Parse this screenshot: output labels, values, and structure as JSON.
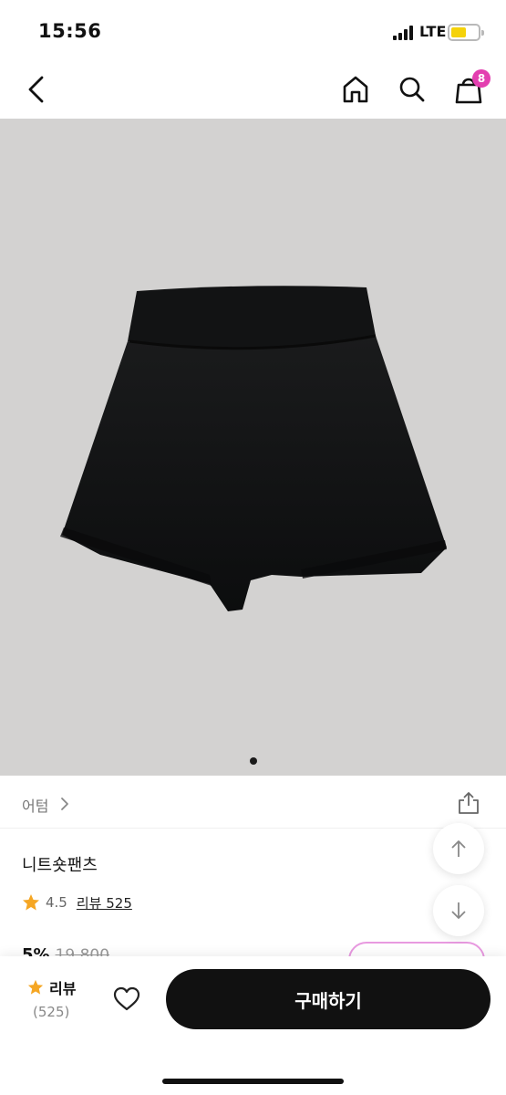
{
  "status_bar": {
    "time": "15:56",
    "network": "LTE",
    "battery_color": "#f5d20a"
  },
  "nav": {
    "back_icon": "chevron-left-icon",
    "home_icon": "home-icon",
    "search_icon": "search-icon",
    "cart_icon": "shopping-bag-icon",
    "cart_count": "8",
    "badge_color": "#e33fb0"
  },
  "product": {
    "image_description_icon": "knit-shorts-photo",
    "carousel": {
      "count": 1,
      "active": 0
    },
    "brand": "어텀",
    "title": "니트숏팬츠",
    "rating": "4.5",
    "review_link": "리뷰 525",
    "discount": "5%",
    "original_price": "19,800"
  },
  "bottom_bar": {
    "review_label": "리뷰",
    "review_count": "(525)",
    "buy_label": "구매하기",
    "like_icon": "heart-icon"
  },
  "colors": {
    "accent": "#e33fb0",
    "star": "#f5a623",
    "buy_button": "#111111"
  }
}
